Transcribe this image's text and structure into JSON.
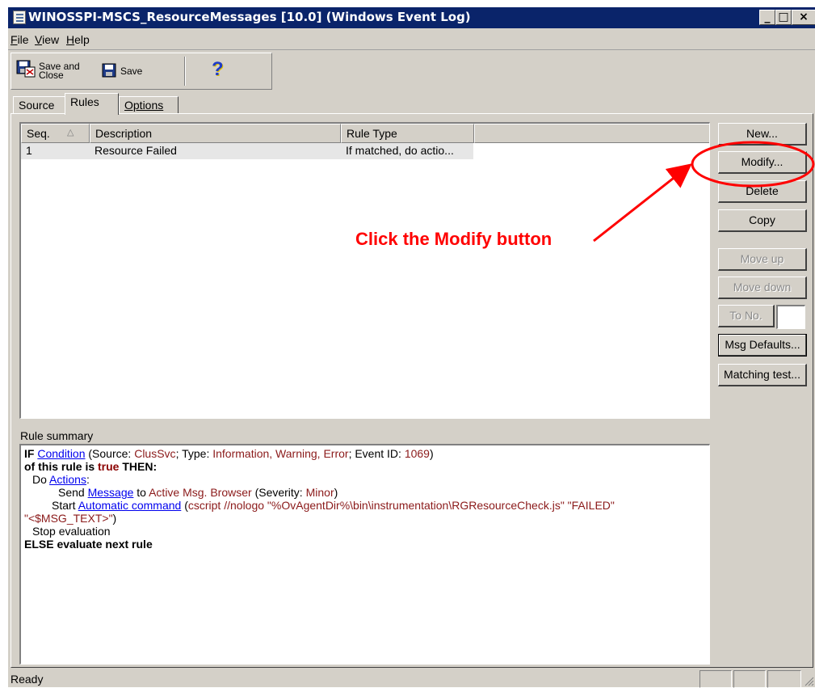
{
  "window": {
    "title": "WINOSSPI-MSCS_ResourceMessages [10.0]  (Windows Event Log)",
    "min_glyph": "_",
    "max_glyph": "□",
    "close_glyph": "×"
  },
  "menu": {
    "items": [
      {
        "accel": "F",
        "rest": "ile"
      },
      {
        "accel": "V",
        "rest": "iew"
      },
      {
        "accel": "H",
        "rest": "elp"
      }
    ]
  },
  "toolbar": {
    "save_close_label": "Save and\nClose",
    "save_label": "Save",
    "help_glyph": "?"
  },
  "tabs": [
    {
      "label": "Source"
    },
    {
      "label": "Rules",
      "active": true
    },
    {
      "label": "Options"
    }
  ],
  "rules_table": {
    "columns": [
      {
        "label": "Seq.",
        "sort_indicator": "△"
      },
      {
        "label": "Description"
      },
      {
        "label": "Rule Type"
      },
      {
        "label": ""
      }
    ],
    "rows": [
      {
        "seq": "1",
        "description": "Resource Failed",
        "rule_type": "If matched, do actio..."
      }
    ]
  },
  "side_buttons": {
    "new": "New...",
    "modify": "Modify...",
    "delete": "Delete",
    "copy": "Copy",
    "move_up": "Move up",
    "move_down": "Move down",
    "to_no": "To No.",
    "msg_defaults": "Msg Defaults...",
    "matching_test": "Matching test..."
  },
  "summary": {
    "label": "Rule summary",
    "if_kw": "IF",
    "condition_link": "Condition",
    "cond_open": " (Source: ",
    "source_val": "ClusSvc",
    "type_lbl": ";  Type: ",
    "type_val": "Information, Warning, Error",
    "event_lbl": ";  Event ID: ",
    "event_val": "1069",
    "cond_close": ")",
    "of_rule": "of this rule is",
    "true_kw": "true",
    "then_kw": "THEN:",
    "do_text": "Do",
    "actions_link": "Actions",
    "actions_colon": ":",
    "send_text": "Send",
    "message_link": "Message",
    "to_text": " to ",
    "browser_val": "Active Msg. Browser",
    "sev_lbl": " (Severity: ",
    "sev_val": "Minor",
    "sev_close": ")",
    "start_text": "Start",
    "auto_link": "Automatic command",
    "cmd_open": " (",
    "cmd_val_1": "cscript //nologo \"%OvAgentDir%\\bin\\instrumentation\\RGResourceCheck.js\" \"FAILED\"",
    "cmd_val_2": "\"<$MSG_TEXT>\"",
    "cmd_close": ")",
    "stop_text": "Stop evaluation",
    "else_text": "ELSE evaluate next rule"
  },
  "status": {
    "text": "Ready"
  },
  "annotation": {
    "text": "Click the Modify button",
    "color": "#ff0000"
  }
}
